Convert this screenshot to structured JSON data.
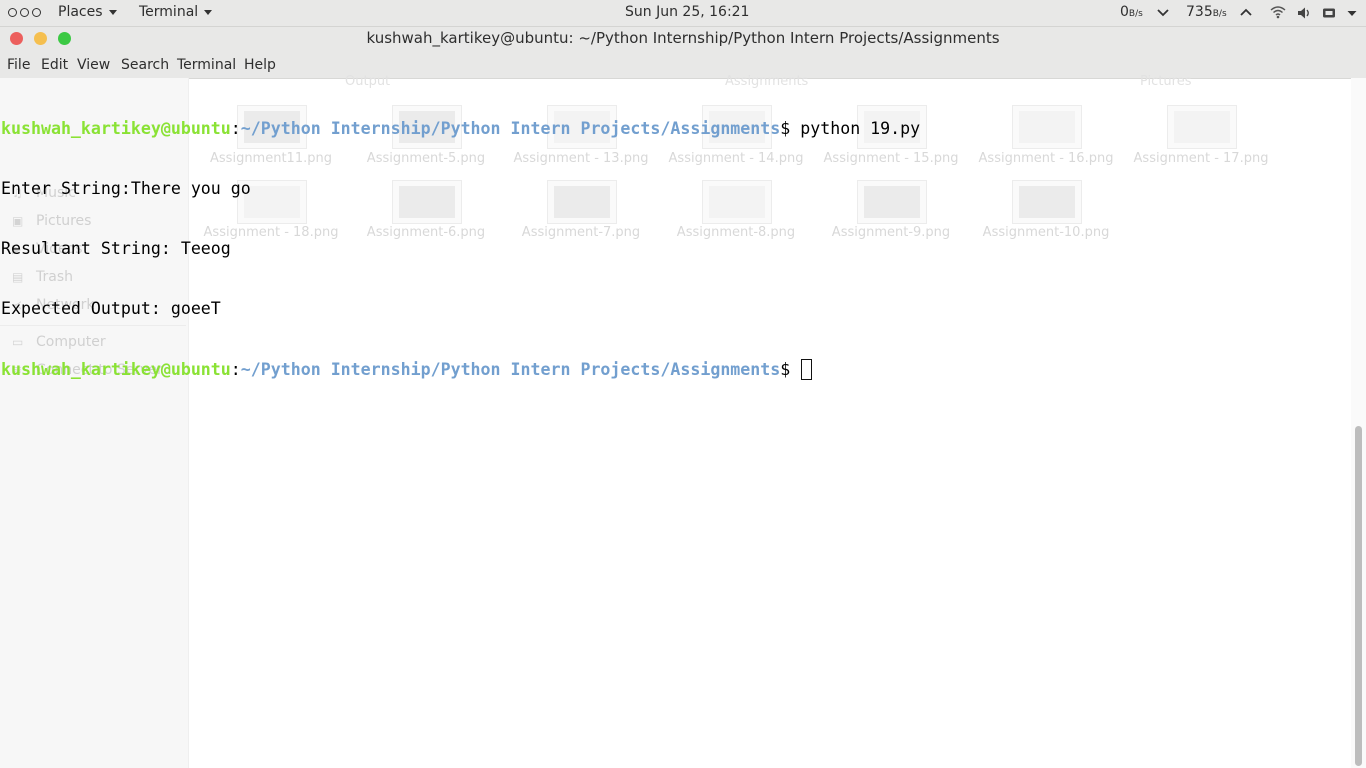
{
  "topbar": {
    "activities_icon": "three-dots-icon",
    "places_label": "Places",
    "app_label": "Terminal",
    "clock": "Sun Jun 25, 16:21",
    "net_down_value": "0",
    "net_down_unit": "B/s",
    "net_up_value": "735",
    "net_up_unit": "B/s",
    "tray_icons": [
      "chevron-down-icon",
      "chevron-up-icon",
      "wifi-icon",
      "volume-icon",
      "battery-icon",
      "caret-down-icon"
    ]
  },
  "window": {
    "title": "kushwah_kartikey@ubuntu: ~/Python Internship/Python Intern Projects/Assignments",
    "buttons": {
      "close_color": "#ec5f5d",
      "minimize_color": "#f5bf4f",
      "maximize_color": "#3cc944"
    }
  },
  "menu": {
    "file": "File",
    "edit": "Edit",
    "view": "View",
    "search": "Search",
    "terminal": "Terminal",
    "help": "Help"
  },
  "terminal": {
    "prompt_user": "kushwah_kartikey@ubuntu",
    "prompt_sep": ":",
    "prompt_path": "~/Python Internship/Python Intern Projects/Assignments",
    "prompt_symbol": "$ ",
    "command": "python 19.py",
    "output": [
      "Enter String:There you go",
      "Resultant String: Teeog",
      "Expected Output: goeeT"
    ],
    "colors": {
      "user": "#8ae234",
      "path": "#729fcf",
      "text": "#000000"
    }
  },
  "background_files": {
    "sidebar": [
      "Music",
      "Pictures",
      "Videos",
      "Trash",
      "Network",
      "Computer",
      "Connect to Server"
    ],
    "sidebar_icons": [
      "music-icon",
      "pictures-icon",
      "videos-icon",
      "trash-icon",
      "network-icon",
      "computer-icon",
      "server-icon"
    ],
    "tabs": [
      "Output",
      "Assignments",
      "Pictures"
    ],
    "row1": [
      "Assignment11.png",
      "Assignment-5.png",
      "Assignment - 13.png",
      "Assignment - 14.png",
      "Assignment - 15.png",
      "Assignment - 16.png",
      "Assignment - 17.png"
    ],
    "row2": [
      "Assignment - 18.png",
      "Assignment-6.png",
      "Assignment-7.png",
      "Assignment-8.png",
      "Assignment-9.png",
      "Assignment-10.png"
    ]
  }
}
